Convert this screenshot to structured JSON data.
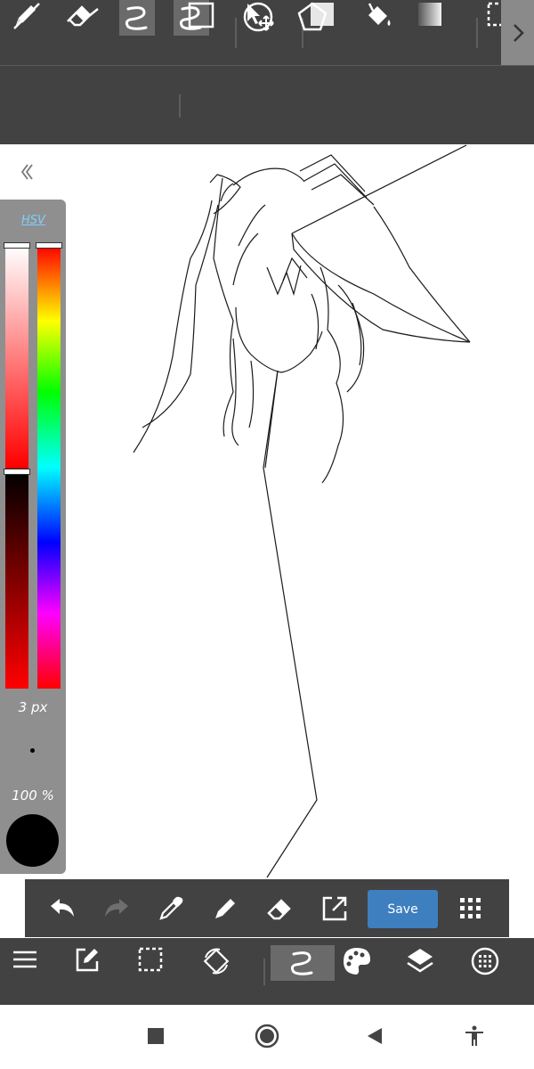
{
  "top_toolbar": {
    "tools": [
      "pen-icon",
      "eraser-icon",
      "hand-icon",
      "curve-brush-icon",
      "move-transform-icon",
      "fill-square-icon",
      "paint-bucket-icon",
      "gradient-icon",
      "selection-icon"
    ],
    "selected": "curve-brush-icon"
  },
  "shape_toolbar": {
    "tools": [
      "line-icon",
      "polyline-icon",
      "curve-icon",
      "rectangle-icon",
      "ellipse-icon",
      "polygon-icon"
    ],
    "selected": "curve-icon"
  },
  "color_panel": {
    "mode_label": "HSV",
    "brush_size": "3 px",
    "opacity": "100 %",
    "current_color": "#000000"
  },
  "quick_bar": {
    "tools": [
      "undo-icon",
      "redo-icon",
      "eyedropper-icon",
      "pen-icon",
      "eraser-icon",
      "export-icon"
    ],
    "save_label": "Save",
    "grid": "grid-icon"
  },
  "bottom_bar": {
    "tools": [
      "menu-icon",
      "edit-icon",
      "selection-icon",
      "rotate-canvas-icon",
      "curve-brush-icon",
      "palette-icon",
      "layers-icon",
      "settings-circle-icon"
    ],
    "selected": "curve-brush-icon"
  },
  "colors": {
    "toolbar": "#424242",
    "selected": "#6a6a6a",
    "accent": "#3d7fbf",
    "hsv_label": "#7fd0ff"
  }
}
